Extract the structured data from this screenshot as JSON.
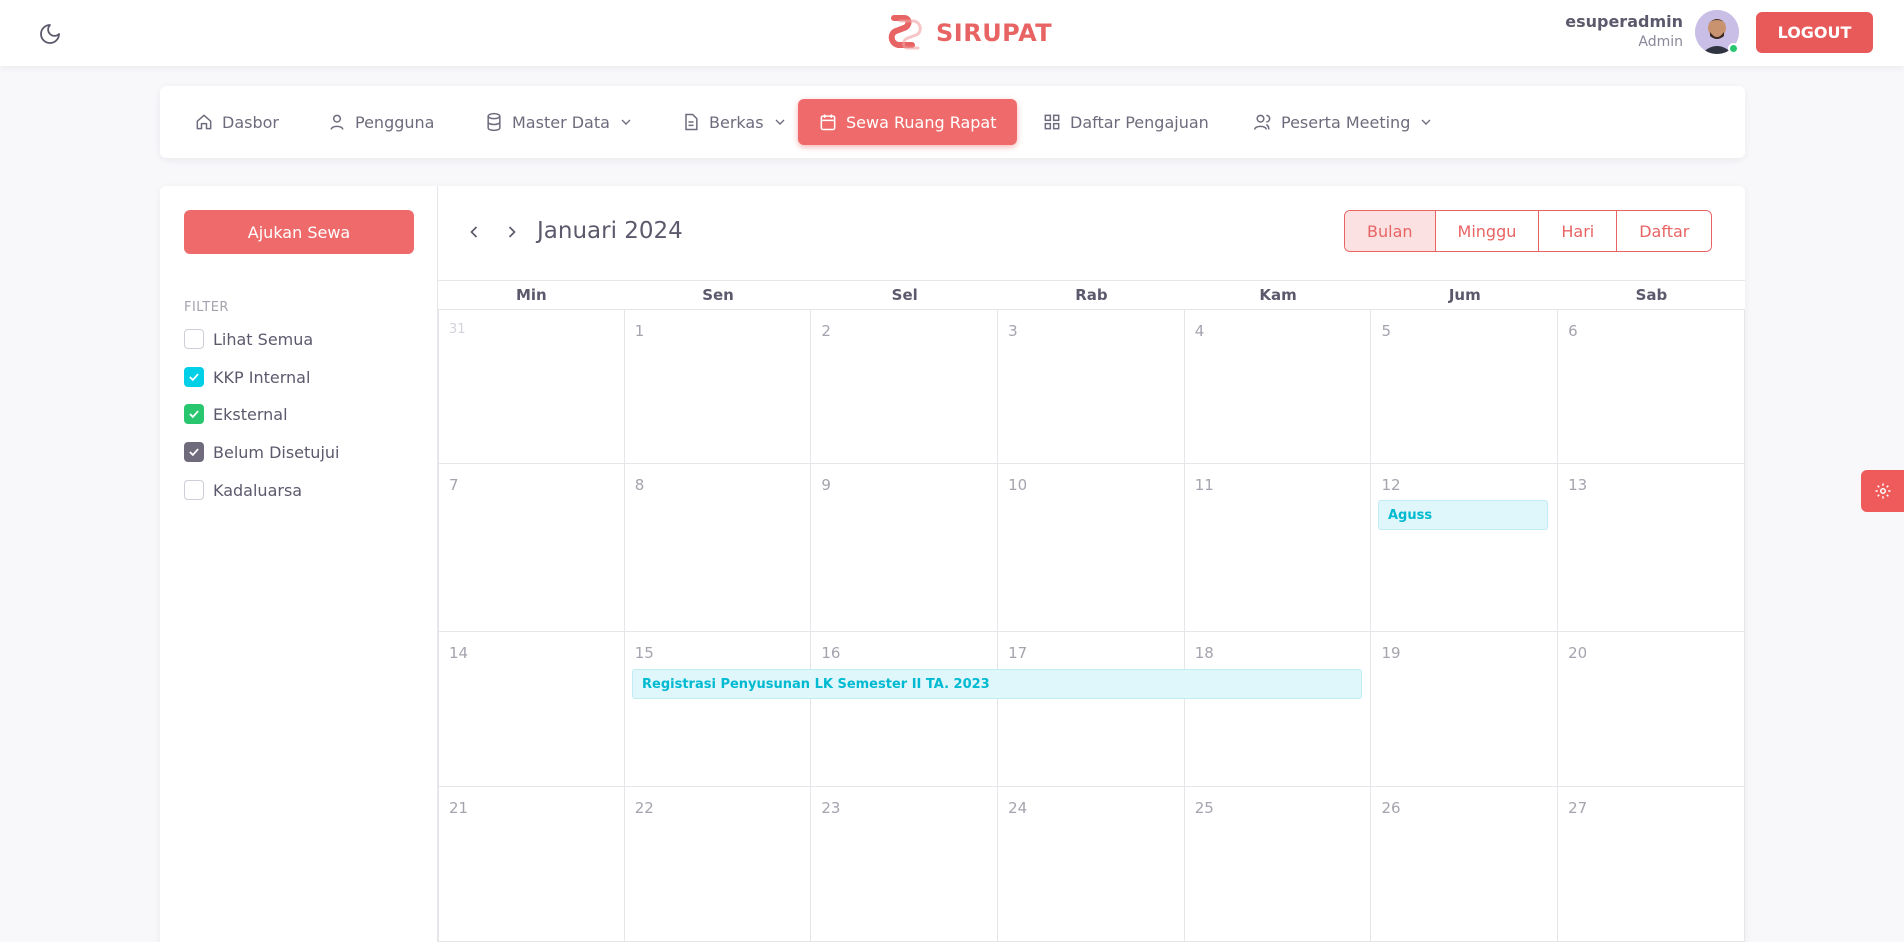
{
  "header": {
    "brand_name": "SIRUPAT",
    "user_name": "esuperadmin",
    "user_role": "Admin",
    "logout_label": "LOGOUT",
    "icons": [
      "moon-icon",
      "brand-logo-icon",
      "avatar"
    ]
  },
  "nav": {
    "items": [
      {
        "label": "Dasbor",
        "icon": "home-icon"
      },
      {
        "label": "Pengguna",
        "icon": "user-icon"
      },
      {
        "label": "Master Data",
        "icon": "database-icon",
        "dropdown": true
      },
      {
        "label": "Berkas",
        "icon": "file-icon",
        "dropdown": true
      },
      {
        "label": "Sewa Ruang Rapat",
        "icon": "calendar-icon",
        "active": true
      },
      {
        "label": "Daftar Pengajuan",
        "icon": "grid-icon"
      },
      {
        "label": "Peserta Meeting",
        "icon": "users-icon",
        "dropdown": true
      }
    ]
  },
  "sidebar": {
    "ajukan_label": "Ajukan Sewa",
    "filter_title": "FILTER",
    "filters": [
      {
        "label": "Lihat Semua",
        "checked": false,
        "color": "#ffffff"
      },
      {
        "label": "KKP Internal",
        "checked": true,
        "color": "#00cfe8"
      },
      {
        "label": "Eksternal",
        "checked": true,
        "color": "#28c76f"
      },
      {
        "label": "Belum Disetujui",
        "checked": true,
        "color": "#6f6b7d"
      },
      {
        "label": "Kadaluarsa",
        "checked": false,
        "color": "#ffffff"
      }
    ]
  },
  "calendar": {
    "title": "Januari 2024",
    "views": [
      {
        "label": "Bulan",
        "active": true
      },
      {
        "label": "Minggu",
        "active": false
      },
      {
        "label": "Hari",
        "active": false
      },
      {
        "label": "Daftar",
        "active": false
      }
    ],
    "days_of_week": [
      "Min",
      "Sen",
      "Sel",
      "Rab",
      "Kam",
      "Jum",
      "Sab"
    ],
    "weeks": [
      [
        "31",
        "1",
        "2",
        "3",
        "4",
        "5",
        "6"
      ],
      [
        "7",
        "8",
        "9",
        "10",
        "11",
        "12",
        "13"
      ],
      [
        "14",
        "15",
        "16",
        "17",
        "18",
        "19",
        "20"
      ],
      [
        "21",
        "22",
        "23",
        "24",
        "25",
        "26",
        "27"
      ]
    ],
    "events": [
      {
        "title": "Aguss",
        "start_day": "12",
        "end_day": "12"
      },
      {
        "title": "Registrasi Penyusunan LK Semester II TA. 2023",
        "start_day": "15",
        "end_day": "18"
      }
    ],
    "event_color": "#00bad1"
  },
  "colors": {
    "accent": "#ef6b6b",
    "brand": "#e86464"
  }
}
